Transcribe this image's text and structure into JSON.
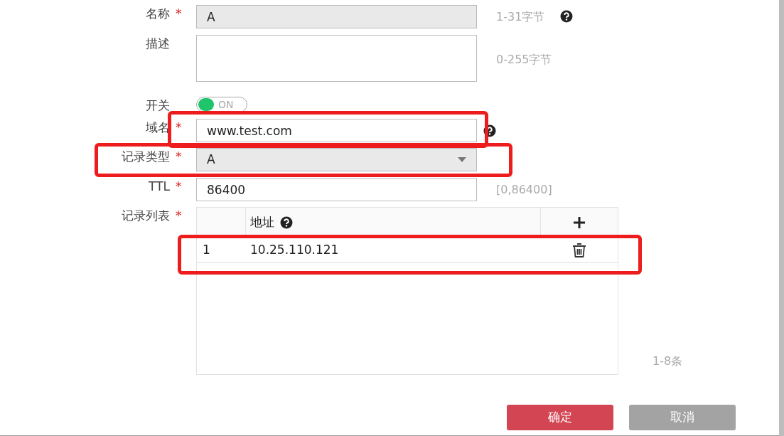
{
  "fields": [
    {
      "kind": "text",
      "label": "名称",
      "required_mark": "*",
      "value": "A",
      "disabled": true,
      "hint": "1-31字节",
      "help": true,
      "highlighted": false
    },
    {
      "kind": "textarea",
      "label": "描述",
      "disabled": false,
      "hint": "0-255字节",
      "help": false,
      "highlighted": false
    },
    {
      "kind": "switch",
      "label": "开关",
      "on": true,
      "switch_text": "ON",
      "highlighted": false
    },
    {
      "kind": "text",
      "label": "域名",
      "required_mark": "*",
      "value": "www.test.com",
      "disabled": false,
      "help": true,
      "highlighted": true
    },
    {
      "kind": "select",
      "label": "记录类型",
      "required_mark": "*",
      "value": "A",
      "disabled": true,
      "highlighted": true
    },
    {
      "kind": "text",
      "label": "TTL",
      "required_mark": "*",
      "value": "86400",
      "disabled": false,
      "hint": "[0,86400]",
      "help": false,
      "highlighted": false
    }
  ],
  "record_list": {
    "label": "记录列表",
    "required_mark": "*",
    "columns": [
      {
        "label": "地址",
        "help": true
      }
    ],
    "rows": [
      {
        "index": "1",
        "address": "10.25.110.121",
        "highlighted": true
      }
    ],
    "hint": "1-8条"
  },
  "buttons": [
    {
      "label": "确定",
      "kind": "primary"
    },
    {
      "label": "取消",
      "kind": "secondary"
    }
  ]
}
